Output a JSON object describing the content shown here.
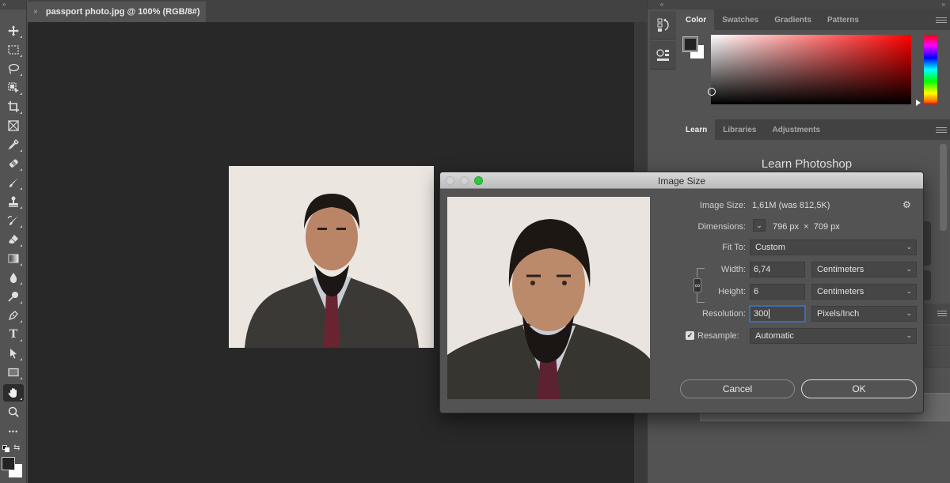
{
  "document": {
    "tab_title": "passport photo.jpg @ 100% (RGB/8#)",
    "close_glyph": "×"
  },
  "toolbar": {
    "collapse_glyph": "»",
    "tools": [
      {
        "name": "move-tool",
        "icon": "move-icon"
      },
      {
        "name": "marquee-tool",
        "icon": "rectangular-marquee-icon"
      },
      {
        "name": "lasso-tool",
        "icon": "lasso-icon"
      },
      {
        "name": "object-selection-tool",
        "icon": "object-selection-icon"
      },
      {
        "name": "crop-tool",
        "icon": "crop-icon"
      },
      {
        "name": "frame-tool",
        "icon": "frame-icon"
      },
      {
        "name": "eyedropper-tool",
        "icon": "eyedropper-icon"
      },
      {
        "name": "healing-brush-tool",
        "icon": "bandage-icon"
      },
      {
        "name": "brush-tool",
        "icon": "brush-icon"
      },
      {
        "name": "clone-stamp-tool",
        "icon": "stamp-icon"
      },
      {
        "name": "history-brush-tool",
        "icon": "history-brush-icon"
      },
      {
        "name": "eraser-tool",
        "icon": "eraser-icon"
      },
      {
        "name": "gradient-tool",
        "icon": "gradient-icon"
      },
      {
        "name": "blur-tool",
        "icon": "drop-icon"
      },
      {
        "name": "dodge-tool",
        "icon": "dodge-icon"
      },
      {
        "name": "pen-tool",
        "icon": "pen-icon"
      },
      {
        "name": "type-tool",
        "icon": "type-icon"
      },
      {
        "name": "path-selection-tool",
        "icon": "arrow-icon"
      },
      {
        "name": "rectangle-tool",
        "icon": "rectangle-icon"
      },
      {
        "name": "hand-tool",
        "icon": "hand-icon",
        "active": true
      },
      {
        "name": "zoom-tool",
        "icon": "zoom-icon"
      },
      {
        "name": "edit-toolbar",
        "icon": "more-icon"
      }
    ],
    "type_glyph": "T",
    "more_glyph": "•••",
    "swap_glyph": "⇆",
    "foreground_color": "#232323",
    "background_color": "#ffffff"
  },
  "right_dock": {
    "collapse_left": "«",
    "collapse_right": "»",
    "buttons": [
      {
        "name": "history-panel-button",
        "icon": "history-icon"
      },
      {
        "name": "properties-panel-button",
        "icon": "properties-icon"
      }
    ]
  },
  "color_panel": {
    "tabs": [
      "Color",
      "Swatches",
      "Gradients",
      "Patterns"
    ],
    "active_tab": "Color",
    "foreground": "#232323",
    "background": "#ffffff",
    "hue_color": "#ff0000"
  },
  "learn_panel": {
    "tabs": [
      "Learn",
      "Libraries",
      "Adjustments"
    ],
    "active_tab": "Learn",
    "title": "Learn Photoshop"
  },
  "image_size_dialog": {
    "title": "Image Size",
    "image_size_label": "Image Size:",
    "image_size_value": "1,61M (was 812,5K)",
    "dimensions_label": "Dimensions:",
    "dimensions_toggle": "⌄",
    "dimensions_width": "796 px",
    "dimensions_times": "×",
    "dimensions_height": "709 px",
    "fit_to_label": "Fit To:",
    "fit_to_value": "Custom",
    "width_label": "Width:",
    "width_value": "6,74",
    "width_unit": "Centimeters",
    "height_label": "Height:",
    "height_value": "6",
    "height_unit": "Centimeters",
    "resolution_label": "Resolution:",
    "resolution_value": "300",
    "resolution_unit": "Pixels/Inch",
    "resample_label": "Resample:",
    "resample_checked": true,
    "resample_check_glyph": "✓",
    "resample_value": "Automatic",
    "cancel_label": "Cancel",
    "ok_label": "OK",
    "chevron": "⌄",
    "gear_glyph": "⚙"
  }
}
